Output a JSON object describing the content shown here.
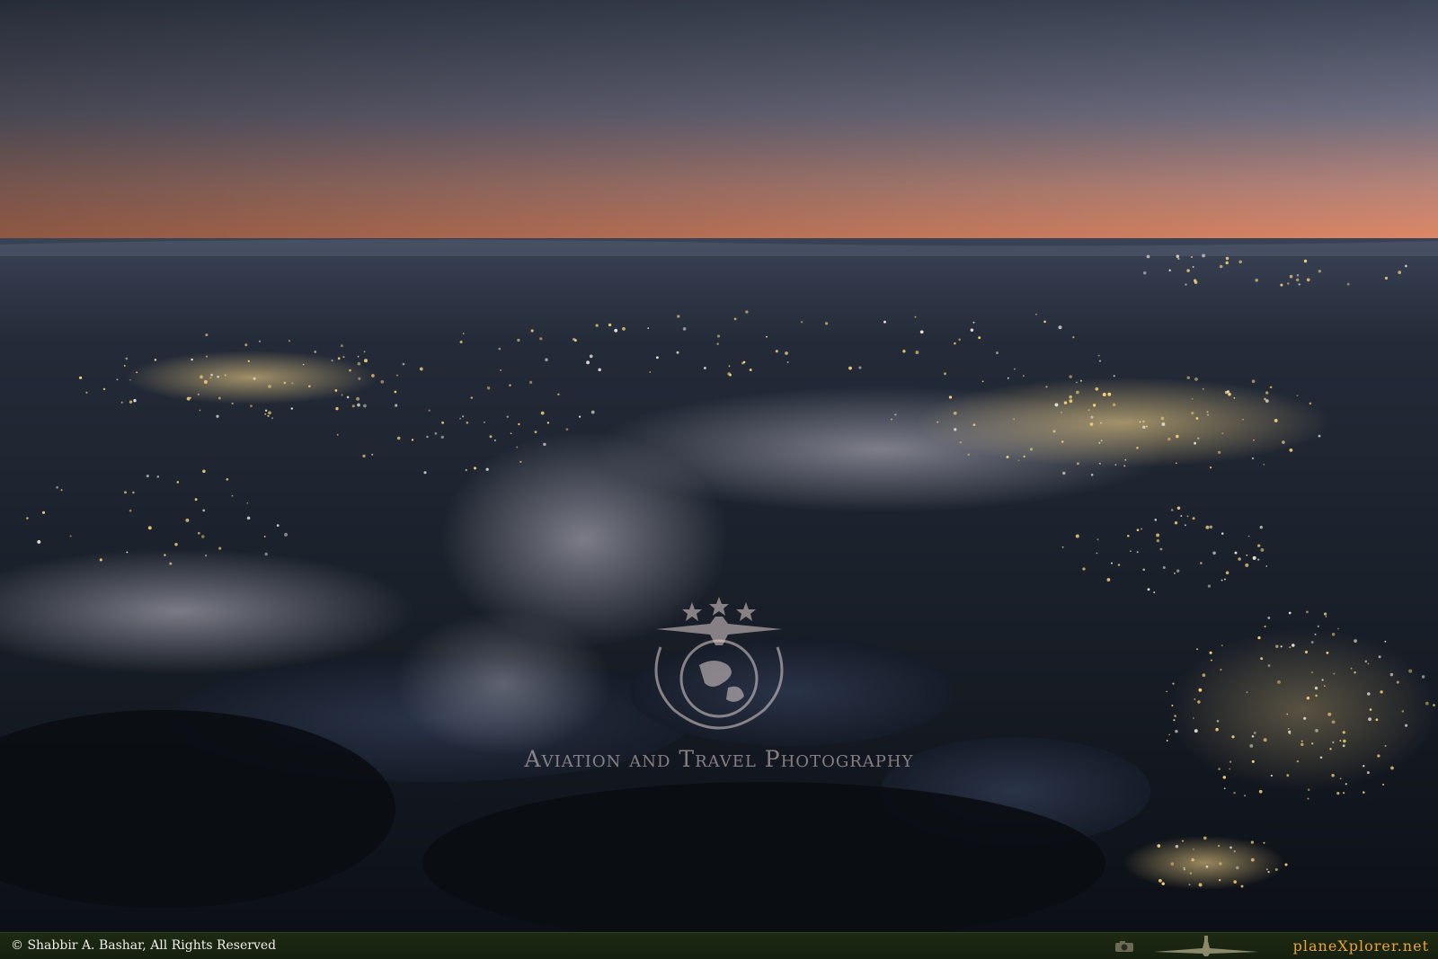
{
  "watermark": {
    "text": "Aviation and Travel Photography",
    "emblem": "globe-and-airplane-emblem"
  },
  "footer": {
    "copyright": "© Shabbir A. Bashar, All Rights Reserved",
    "site": "planeXplorer.net",
    "icons": [
      "camera-icon",
      "airplane-icon"
    ]
  },
  "colors": {
    "sky_top": "#3d4658",
    "sky_horizon": "#e07a5a",
    "ground": "#161b24",
    "city_lights": "#f4d27a",
    "footer_bg": "#1e2a12",
    "brand": "#e8a33a"
  }
}
